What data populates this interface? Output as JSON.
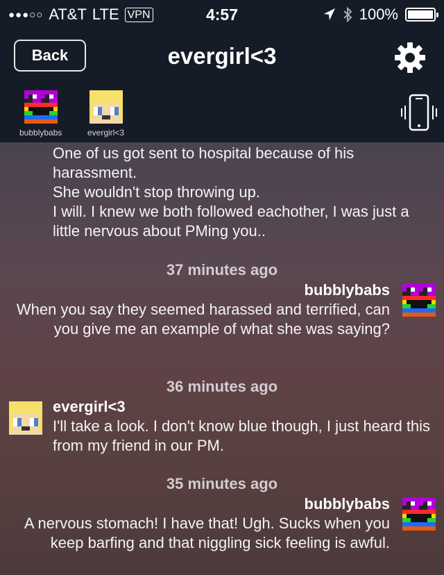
{
  "status_bar": {
    "signal": "●●●○○",
    "carrier": "AT&T",
    "network": "LTE",
    "vpn": "VPN",
    "time": "4:57",
    "battery": "100%"
  },
  "nav": {
    "back_label": "Back",
    "title": "evergirl<3"
  },
  "participants": [
    {
      "name": "bubblybabs"
    },
    {
      "name": "evergirl<3"
    }
  ],
  "messages": {
    "m1_lines": [
      "One of us got sent to hospital because of his harassment.",
      "She wouldn't stop throwing up.",
      "I will. I knew we both followed eachother, I was just a little nervous about PMing you.."
    ],
    "ts1": "37 minutes ago",
    "m2_sender": "bubblybabs",
    "m2_text": "When you say they seemed harassed and terrified, can you give me an example of what she was saying?",
    "ts2": "36 minutes ago",
    "m3_sender": "evergirl<3",
    "m3_text": "I'll take a look. I don't know blue though, I just heard this from my friend in our PM.",
    "ts3": "35 minutes ago",
    "m4_sender": "bubblybabs",
    "m4_text": "A nervous stomach!  I have that!  Ugh.  Sucks when you keep barfing and that niggling sick feeling is awful."
  },
  "colors": {
    "header_bg": "#161c27",
    "timestamp": "#d3cdd0",
    "avatar_rainbow": [
      "#b400d8",
      "#ff2a2a",
      "#ffd400",
      "#2bd42b",
      "#1a6cff"
    ],
    "avatar_blonde": "#f7e06a"
  },
  "icons": {
    "settings": "gear-icon",
    "vibrate": "phone-vibrate-icon",
    "location": "location-arrow-icon",
    "bluetooth": "bluetooth-icon"
  }
}
